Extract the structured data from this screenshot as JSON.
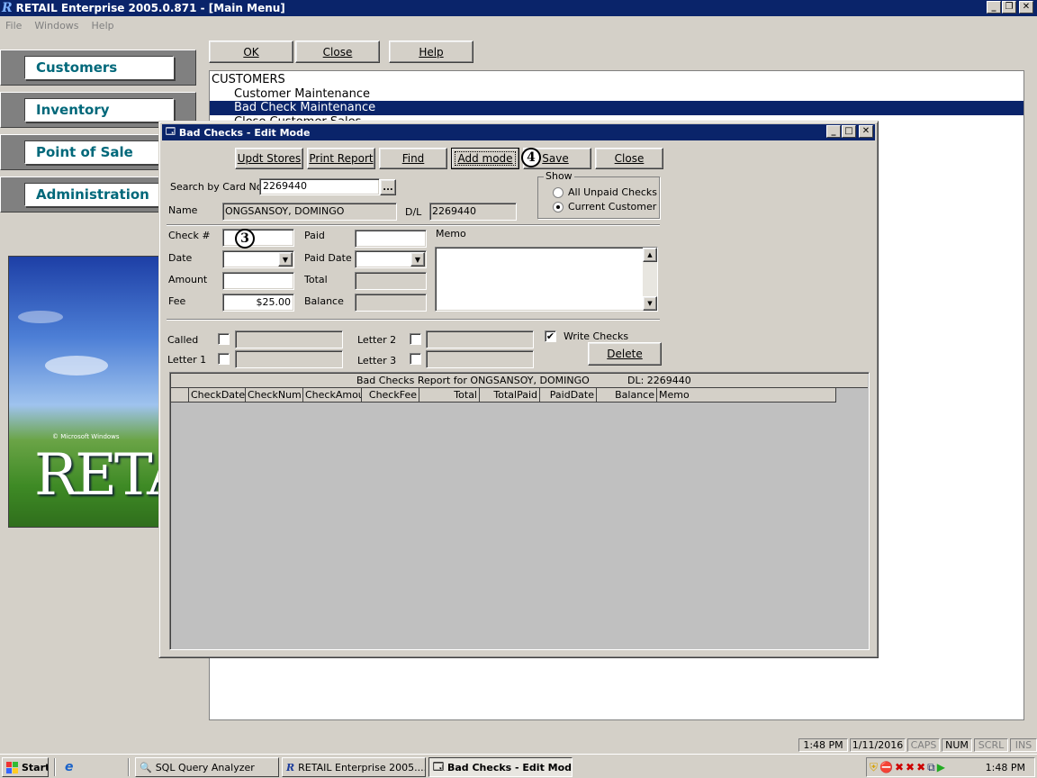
{
  "app": {
    "title": "RETAIL Enterprise 2005.0.871 - [Main Menu]",
    "menu": [
      "File",
      "Windows",
      "Help"
    ]
  },
  "nav": {
    "items": [
      "Customers",
      "Inventory",
      "Point of Sale",
      "Administration"
    ]
  },
  "toolbar": {
    "ok": "OK",
    "close": "Close",
    "help": "Help"
  },
  "menu_list": {
    "items": [
      "CUSTOMERS",
      "Customer Maintenance",
      "Bad Check Maintenance",
      "Close Customer Sales"
    ],
    "selected_index": 2
  },
  "splash": {
    "brand": "RETAIL",
    "small_text": "© Microsoft Windows"
  },
  "dialog": {
    "title": "Bad Checks - Edit Mode",
    "buttons": {
      "updt_stores": "Updt Stores",
      "print_report": "Print Report",
      "find": "Find",
      "add_mode": "Add mode",
      "save": "Save",
      "close": "Close"
    },
    "search_label": "Search by Card No.",
    "search_value": "2269440",
    "browse": "...",
    "show_group": "Show",
    "show_options": [
      "All Unpaid Checks",
      "Current Customer"
    ],
    "show_selected": 1,
    "name_label": "Name",
    "name_value": "ONGSANSOY, DOMINGO",
    "dl_label": "D/L",
    "dl_value": "2269440",
    "check_label": "Check #",
    "date_label": "Date",
    "amount_label": "Amount",
    "fee_label": "Fee",
    "fee_value": "$25.00",
    "paid_label": "Paid",
    "paid_date_label": "Paid Date",
    "total_label": "Total",
    "balance_label": "Balance",
    "memo_label": "Memo",
    "called_label": "Called",
    "letter1_label": "Letter 1",
    "letter2_label": "Letter 2",
    "letter3_label": "Letter 3",
    "write_checks_label": "Write Checks",
    "write_checks_checked": true,
    "delete": "Delete",
    "report_title": "Bad Checks Report for ONGSANSOY, DOMINGO",
    "report_dl": "DL: 2269440",
    "columns": [
      "CheckDate",
      "CheckNum",
      "CheckAmou",
      "CheckFee",
      "Total",
      "TotalPaid",
      "PaidDate",
      "Balance",
      "Memo"
    ],
    "callout_check": "3",
    "callout_save": "4"
  },
  "status": {
    "time": "1:48 PM",
    "date": "1/11/2016",
    "caps": "CAPS",
    "num": "NUM",
    "scrl": "SCRL",
    "ins": "INS"
  },
  "taskbar": {
    "start": "Start",
    "tasks": [
      "SQL Query Analyzer",
      "RETAIL Enterprise 2005....",
      "Bad Checks - Edit Mode"
    ],
    "clock": "1:48 PM"
  },
  "colors": {
    "title_blue": "#0a246a",
    "accent_teal": "#00687a",
    "face": "#d4d0c8"
  }
}
